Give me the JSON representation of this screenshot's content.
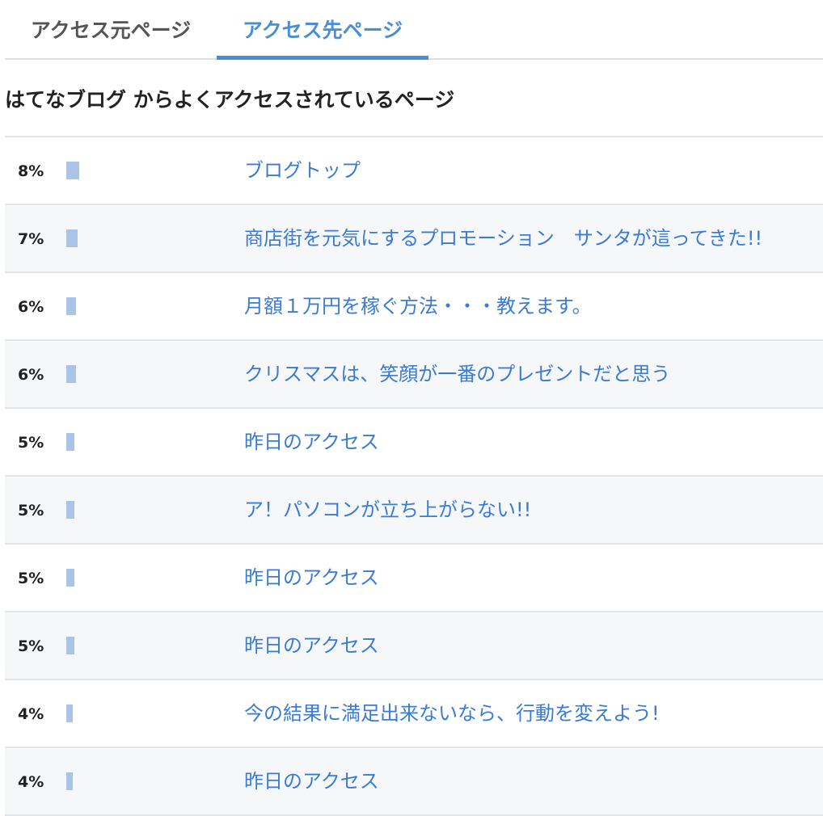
{
  "tabs": [
    {
      "label": "アクセス元ページ",
      "active": false
    },
    {
      "label": "アクセス先ページ",
      "active": true
    }
  ],
  "heading": "はてなブログ からよくアクセスされているページ",
  "colors": {
    "accent": "#4a8ed6",
    "bar": "#a9c4e6",
    "link": "#3a7bd5"
  },
  "rows": [
    {
      "percent": "8%",
      "value": 8,
      "title": "ブログトップ"
    },
    {
      "percent": "7%",
      "value": 7,
      "title": "商店街を元気にするプロモーション　サンタが這ってきた!!"
    },
    {
      "percent": "6%",
      "value": 6,
      "title": "月額１万円を稼ぐ方法・・・教えます。"
    },
    {
      "percent": "6%",
      "value": 6,
      "title": "クリスマスは、笑顔が一番のプレゼントだと思う"
    },
    {
      "percent": "5%",
      "value": 5,
      "title": "昨日のアクセス"
    },
    {
      "percent": "5%",
      "value": 5,
      "title": "ア！パソコンが立ち上がらない!!"
    },
    {
      "percent": "5%",
      "value": 5,
      "title": "昨日のアクセス"
    },
    {
      "percent": "5%",
      "value": 5,
      "title": "昨日のアクセス"
    },
    {
      "percent": "4%",
      "value": 4,
      "title": "今の結果に満足出来ないなら、行動を変えよう!"
    },
    {
      "percent": "4%",
      "value": 4,
      "title": "昨日のアクセス"
    }
  ]
}
